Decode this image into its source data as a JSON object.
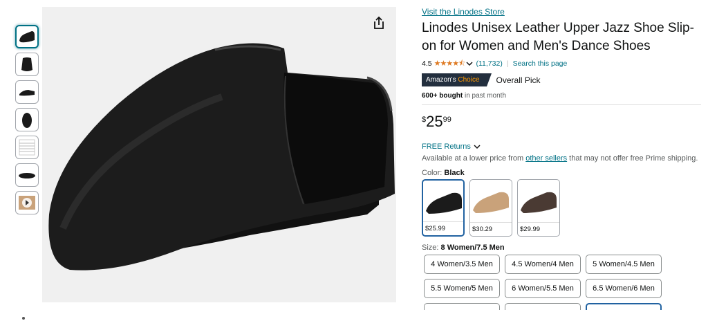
{
  "thumbnails": [
    {
      "name": "thumb-side-view",
      "selected": true
    },
    {
      "name": "thumb-back-view"
    },
    {
      "name": "thumb-sole-view"
    },
    {
      "name": "thumb-front-view"
    },
    {
      "name": "thumb-size-chart"
    },
    {
      "name": "thumb-bottom-view"
    },
    {
      "name": "thumb-video"
    }
  ],
  "product": {
    "store_link": "Visit the Linodes Store",
    "title": "Linodes Unisex Leather Upper Jazz Shoe Slip-on for Women and Men's Dance Shoes",
    "rating_value": "4.5",
    "stars": "★★★★⯪",
    "review_count": "(11,732)",
    "search_link": "Search this page",
    "badge_prefix": "Amazon's",
    "badge_choice": "Choice",
    "overall_pick": "Overall Pick",
    "bought_strong": "600+ bought",
    "bought_rest": " in past month",
    "price_symbol": "$",
    "price_whole": "25",
    "price_fraction": "99",
    "returns": "FREE Returns",
    "avail_pre": "Available at a lower price from ",
    "avail_link": "other sellers",
    "avail_post": " that may not offer free Prime shipping.",
    "color_label": "Color: ",
    "color_value": "Black",
    "size_label": "Size: ",
    "size_value": "8 Women/7.5 Men"
  },
  "colors": [
    {
      "price": "$25.99",
      "hex": "#1b1b1b",
      "selected": true
    },
    {
      "price": "$30.29",
      "hex": "#c9a27a"
    },
    {
      "price": "$29.99",
      "hex": "#4a3a33"
    }
  ],
  "sizes": [
    "4 Women/3.5 Men",
    "4.5 Women/4 Men",
    "5 Women/4.5 Men",
    "5.5 Women/5 Men",
    "6 Women/5.5 Men",
    "6.5 Women/6 Men"
  ],
  "accent": {
    "link": "#007185",
    "star": "#de7921",
    "selected": "#2162a1"
  }
}
